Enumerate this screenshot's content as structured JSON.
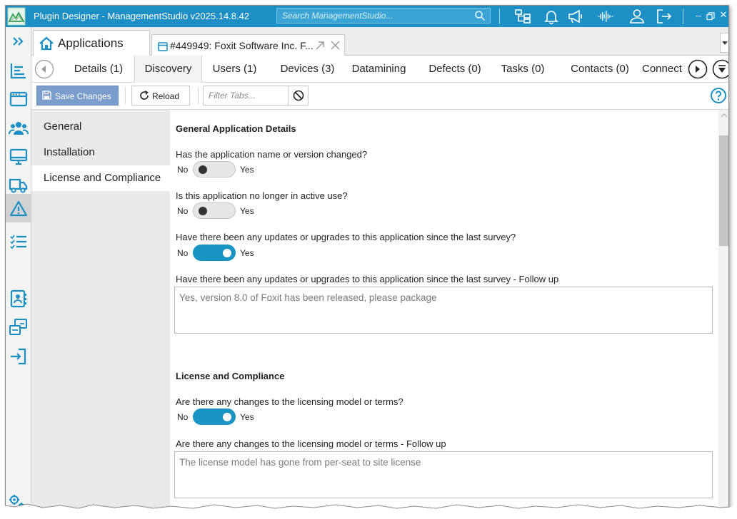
{
  "titlebar": {
    "title": "Plugin Designer - ManagementStudio v2025.14.8.42",
    "search_placeholder": "Search ManagementStudio...",
    "accent_color": "#1c8fc4",
    "icons": [
      "org-chart-icon",
      "bell-icon",
      "megaphone-icon",
      "voice-icon",
      "user-icon",
      "logout-icon"
    ]
  },
  "doc_tabs": {
    "home_label": "Applications",
    "record_label": "#449949: Foxit Software Inc. F..."
  },
  "sub_tabs": [
    {
      "label": "Details (1)"
    },
    {
      "label": "Discovery"
    },
    {
      "label": "Users (1)"
    },
    {
      "label": "Devices (3)"
    },
    {
      "label": "Datamining"
    },
    {
      "label": "Defects (0)"
    },
    {
      "label": "Tasks (0)"
    },
    {
      "label": "Contacts (0)"
    },
    {
      "label": "Connect"
    }
  ],
  "toolbar": {
    "save_label": "Save Changes",
    "reload_label": "Reload",
    "filter_placeholder": "Filter Tabs..."
  },
  "section_nav": [
    {
      "label": "General"
    },
    {
      "label": "Installation"
    },
    {
      "label": "License and Compliance"
    }
  ],
  "form": {
    "general_heading": "General Application Details",
    "q1": {
      "text": "Has the application name or version changed?",
      "no": "No",
      "yes": "Yes",
      "value": false
    },
    "q2": {
      "text": "Is this application no longer in active use?",
      "no": "No",
      "yes": "Yes",
      "value": false
    },
    "q3": {
      "text": "Have there been any updates or upgrades to this application since the last survey?",
      "no": "No",
      "yes": "Yes",
      "value": true
    },
    "q3_followup": {
      "text": "Have there been any updates or upgrades to this application since the last survey - Follow up",
      "value": "Yes, version 8.0 of Foxit has been released, please package"
    },
    "license_heading": "License and Compliance",
    "q4": {
      "text": "Are there any changes to the licensing model or terms?",
      "no": "No",
      "yes": "Yes",
      "value": true
    },
    "q4_followup": {
      "text": "Are there any changes to the licensing model or terms - Follow up",
      "value": "The license model has gone from per-seat to site license"
    }
  },
  "colors": {
    "toggle_on": "#1a94c3",
    "save_button": "#7a9dcc",
    "nav_icon": "#1a8fc4"
  }
}
